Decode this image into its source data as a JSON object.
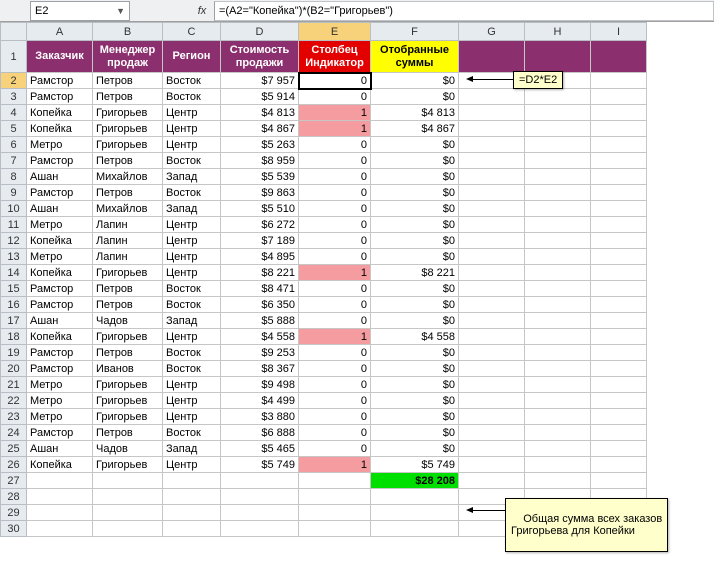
{
  "formula_bar": {
    "namebox_value": "E2",
    "fx_label": "fx",
    "formula": "=(A2=\"Копейка\")*(B2=\"Григорьев\")"
  },
  "column_letters": [
    "A",
    "B",
    "C",
    "D",
    "E",
    "F",
    "G",
    "H",
    "I"
  ],
  "header": {
    "A": "Заказчик",
    "B": "Менеджер продаж",
    "C": "Регион",
    "D": "Стоимость продажи",
    "E": "Столбец Индикатор",
    "F": "Отобранные суммы"
  },
  "rows": [
    {
      "n": 2,
      "A": "Рамстор",
      "B": "Петров",
      "C": "Восток",
      "D": "$7 957",
      "E": "0",
      "F": "$0",
      "active": true
    },
    {
      "n": 3,
      "A": "Рамстор",
      "B": "Петров",
      "C": "Восток",
      "D": "$5 914",
      "E": "0",
      "F": "$0"
    },
    {
      "n": 4,
      "A": "Копейка",
      "B": "Григорьев",
      "C": "Центр",
      "D": "$4 813",
      "E": "1",
      "F": "$4 813",
      "hl": true
    },
    {
      "n": 5,
      "A": "Копейка",
      "B": "Григорьев",
      "C": "Центр",
      "D": "$4 867",
      "E": "1",
      "F": "$4 867",
      "hl": true
    },
    {
      "n": 6,
      "A": "Метро",
      "B": "Григорьев",
      "C": "Центр",
      "D": "$5 263",
      "E": "0",
      "F": "$0"
    },
    {
      "n": 7,
      "A": "Рамстор",
      "B": "Петров",
      "C": "Восток",
      "D": "$8 959",
      "E": "0",
      "F": "$0"
    },
    {
      "n": 8,
      "A": "Ашан",
      "B": "Михайлов",
      "C": "Запад",
      "D": "$5 539",
      "E": "0",
      "F": "$0"
    },
    {
      "n": 9,
      "A": "Рамстор",
      "B": "Петров",
      "C": "Восток",
      "D": "$9 863",
      "E": "0",
      "F": "$0"
    },
    {
      "n": 10,
      "A": "Ашан",
      "B": "Михайлов",
      "C": "Запад",
      "D": "$5 510",
      "E": "0",
      "F": "$0"
    },
    {
      "n": 11,
      "A": "Метро",
      "B": "Лапин",
      "C": "Центр",
      "D": "$6 272",
      "E": "0",
      "F": "$0"
    },
    {
      "n": 12,
      "A": "Копейка",
      "B": "Лапин",
      "C": "Центр",
      "D": "$7 189",
      "E": "0",
      "F": "$0"
    },
    {
      "n": 13,
      "A": "Метро",
      "B": "Лапин",
      "C": "Центр",
      "D": "$4 895",
      "E": "0",
      "F": "$0"
    },
    {
      "n": 14,
      "A": "Копейка",
      "B": "Григорьев",
      "C": "Центр",
      "D": "$8 221",
      "E": "1",
      "F": "$8 221",
      "hl": true
    },
    {
      "n": 15,
      "A": "Рамстор",
      "B": "Петров",
      "C": "Восток",
      "D": "$8 471",
      "E": "0",
      "F": "$0"
    },
    {
      "n": 16,
      "A": "Рамстор",
      "B": "Петров",
      "C": "Восток",
      "D": "$6 350",
      "E": "0",
      "F": "$0"
    },
    {
      "n": 17,
      "A": "Ашан",
      "B": "Чадов",
      "C": "Запад",
      "D": "$5 888",
      "E": "0",
      "F": "$0"
    },
    {
      "n": 18,
      "A": "Копейка",
      "B": "Григорьев",
      "C": "Центр",
      "D": "$4 558",
      "E": "1",
      "F": "$4 558",
      "hl": true
    },
    {
      "n": 19,
      "A": "Рамстор",
      "B": "Петров",
      "C": "Восток",
      "D": "$9 253",
      "E": "0",
      "F": "$0"
    },
    {
      "n": 20,
      "A": "Рамстор",
      "B": "Иванов",
      "C": "Восток",
      "D": "$8 367",
      "E": "0",
      "F": "$0"
    },
    {
      "n": 21,
      "A": "Метро",
      "B": "Григорьев",
      "C": "Центр",
      "D": "$9 498",
      "E": "0",
      "F": "$0"
    },
    {
      "n": 22,
      "A": "Метро",
      "B": "Григорьев",
      "C": "Центр",
      "D": "$4 499",
      "E": "0",
      "F": "$0"
    },
    {
      "n": 23,
      "A": "Метро",
      "B": "Григорьев",
      "C": "Центр",
      "D": "$3 880",
      "E": "0",
      "F": "$0"
    },
    {
      "n": 24,
      "A": "Рамстор",
      "B": "Петров",
      "C": "Восток",
      "D": "$6 888",
      "E": "0",
      "F": "$0"
    },
    {
      "n": 25,
      "A": "Ашан",
      "B": "Чадов",
      "C": "Запад",
      "D": "$5 465",
      "E": "0",
      "F": "$0"
    },
    {
      "n": 26,
      "A": "Копейка",
      "B": "Григорьев",
      "C": "Центр",
      "D": "$5 749",
      "E": "1",
      "F": "$5 749",
      "hl": true
    }
  ],
  "sum_row": {
    "n": 27,
    "F": "$28 208"
  },
  "extra_rows": [
    28,
    29,
    30
  ],
  "callouts": {
    "top": "=D2*E2",
    "bottom": "Общая сумма всех заказов\nГригорьева для Копейки"
  },
  "active_col": "E",
  "active_row": 2
}
